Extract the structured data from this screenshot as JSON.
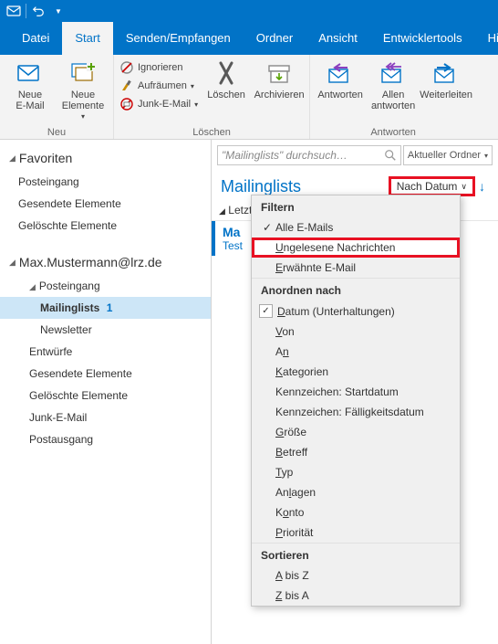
{
  "titlebar": {
    "undo_tooltip": "Rückgängig"
  },
  "menubar": {
    "tabs": [
      "Datei",
      "Start",
      "Senden/Empfangen",
      "Ordner",
      "Ansicht",
      "Entwicklertools",
      "Hilfe"
    ],
    "active_index": 1
  },
  "ribbon": {
    "group_neu": {
      "label": "Neu",
      "new_email": "Neue\nE-Mail",
      "new_items": "Neue\nElemente"
    },
    "group_loeschen": {
      "label": "Löschen",
      "ignore": "Ignorieren",
      "cleanup": "Aufräumen",
      "junk": "Junk-E-Mail",
      "delete": "Löschen",
      "archive": "Archivieren"
    },
    "group_antworten": {
      "label": "Antworten",
      "reply": "Antworten",
      "reply_all": "Allen\nantworten",
      "forward": "Weiterleiten"
    }
  },
  "nav": {
    "favorites": {
      "header": "Favoriten",
      "items": [
        "Posteingang",
        "Gesendete Elemente",
        "Gelöschte Elemente"
      ]
    },
    "account": {
      "header": "Max.Mustermann@lrz.de",
      "inbox": "Posteingang",
      "inbox_children": [
        {
          "name": "Mailinglists",
          "count": "1",
          "selected": true
        },
        {
          "name": "Newsletter"
        }
      ],
      "drafts": "Entwürfe",
      "sent": "Gesendete Elemente",
      "deleted": "Gelöschte Elemente",
      "junk": "Junk-E-Mail",
      "outbox": "Postausgang"
    }
  },
  "list": {
    "search_placeholder": "\"Mailinglists\" durchsuch…",
    "scope": "Aktueller Ordner",
    "folder_title": "Mailinglists",
    "sort_label": "Nach Datum",
    "group_header": "Letzt",
    "msg_from": "Ma",
    "msg_subj": "Test"
  },
  "dropdown": {
    "section_filter": "Filtern",
    "filter_items": [
      {
        "label": "Alle E-Mails",
        "checked": true
      },
      {
        "label": "Ungelesene Nachrichten",
        "highlight": true
      },
      {
        "label": "Erwähnte E-Mail"
      }
    ],
    "section_arrange": "Anordnen nach",
    "arrange_items": [
      {
        "label": "Datum (Unterhaltungen)",
        "checked": true,
        "u": "D"
      },
      {
        "label": "Von",
        "u": "V"
      },
      {
        "label": "An",
        "u": "A"
      },
      {
        "label": "Kategorien",
        "u": "K"
      },
      {
        "label": "Kennzeichen: Startdatum"
      },
      {
        "label": "Kennzeichen: Fälligkeitsdatum"
      },
      {
        "label": "Größe",
        "u": "G"
      },
      {
        "label": "Betreff",
        "u": "B"
      },
      {
        "label": "Typ",
        "u": "T"
      },
      {
        "label": "Anlagen"
      },
      {
        "label": "Konto",
        "u": "K"
      },
      {
        "label": "Priorität",
        "u": "P"
      }
    ],
    "section_sort": "Sortieren",
    "sort_items": [
      {
        "label": "A bis Z",
        "u": "A"
      },
      {
        "label": "Z bis A",
        "u": "Z"
      }
    ]
  }
}
